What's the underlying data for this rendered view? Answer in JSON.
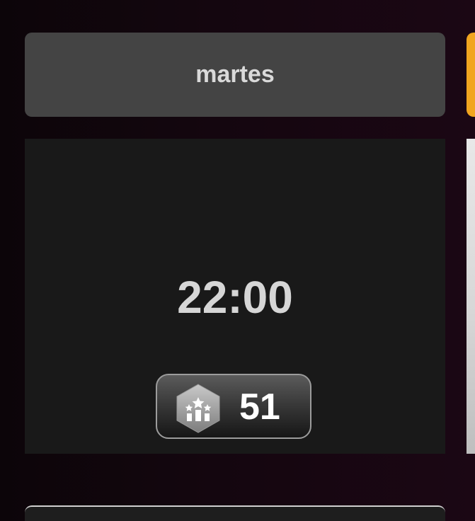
{
  "schedule": {
    "selected_day": "martes",
    "slot": {
      "time": "22:00",
      "rank_badge": {
        "icon": "podium-stars-icon",
        "count": "51"
      }
    }
  },
  "colors": {
    "tab_background": "#444444",
    "next_tab_accent": "#f1a51f",
    "card_background": "#191919",
    "page_background": "#14060f"
  }
}
